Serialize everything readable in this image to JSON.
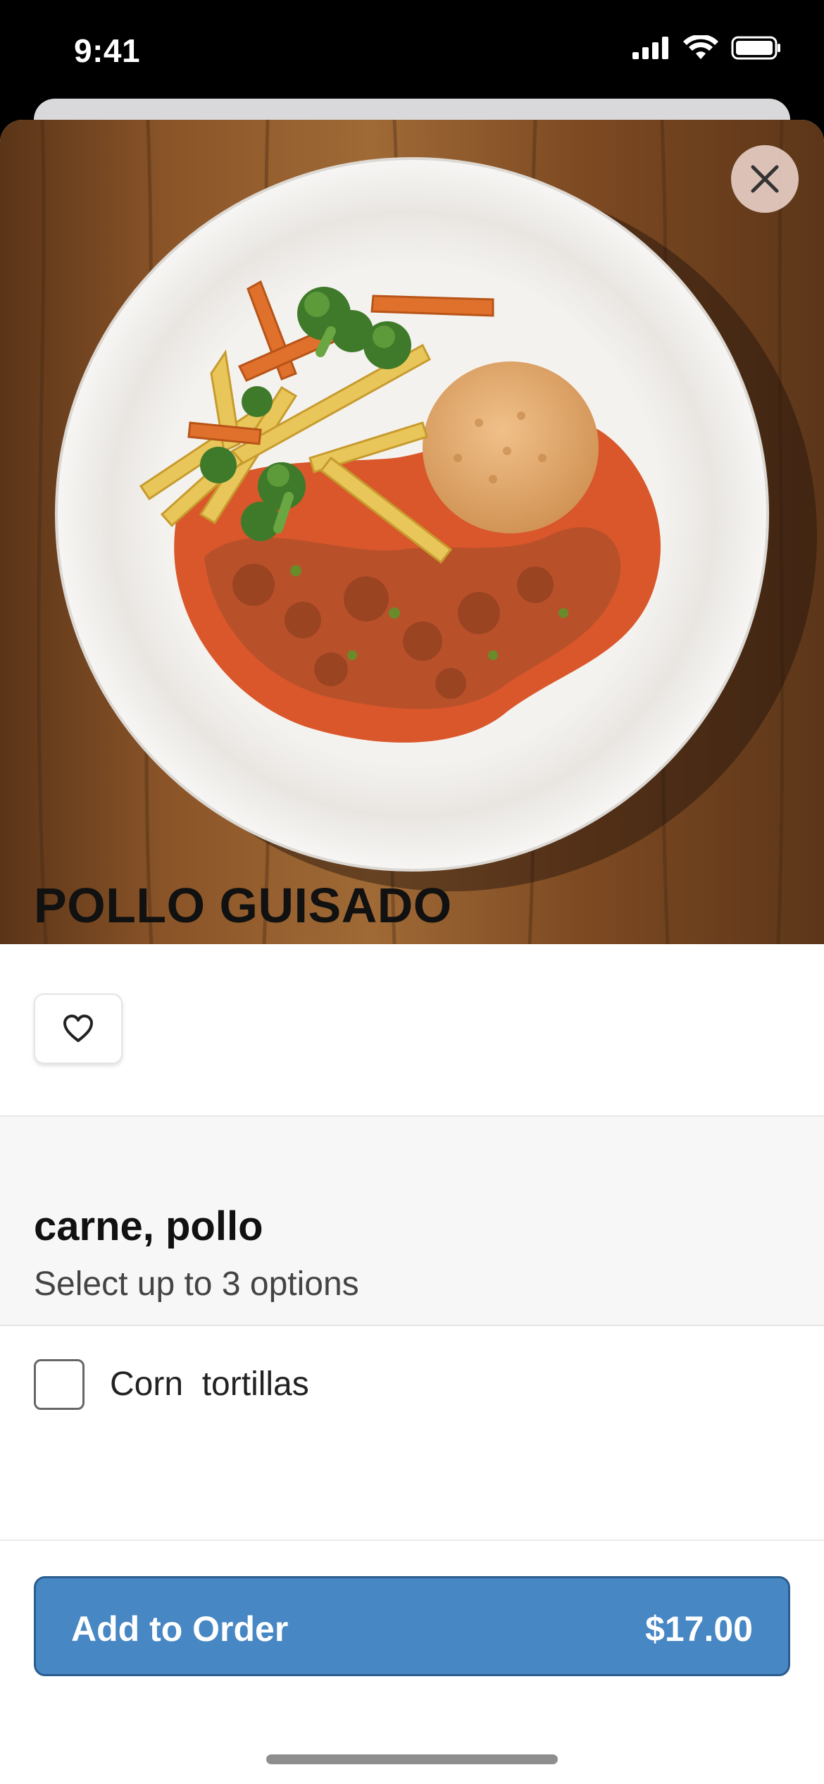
{
  "status_bar": {
    "time": "9:41"
  },
  "product": {
    "title": "POLLO GUISADO",
    "image_alt": "Pollo guisado with rice and vegetables on a white plate"
  },
  "modifier_group": {
    "title": "carne, pollo",
    "subtitle": "Select up to 3 options",
    "options": [
      {
        "label": "Corn  tortillas",
        "checked": false
      }
    ]
  },
  "footer": {
    "add_label": "Add to Order",
    "price": "$17.00"
  },
  "colors": {
    "accent": "#4787c4",
    "accent_border": "#2b5d8f"
  },
  "icons": {
    "close": "close-icon",
    "favorite": "heart-outline-icon",
    "signal": "cellular-signal-icon",
    "wifi": "wifi-icon",
    "battery": "battery-icon"
  }
}
